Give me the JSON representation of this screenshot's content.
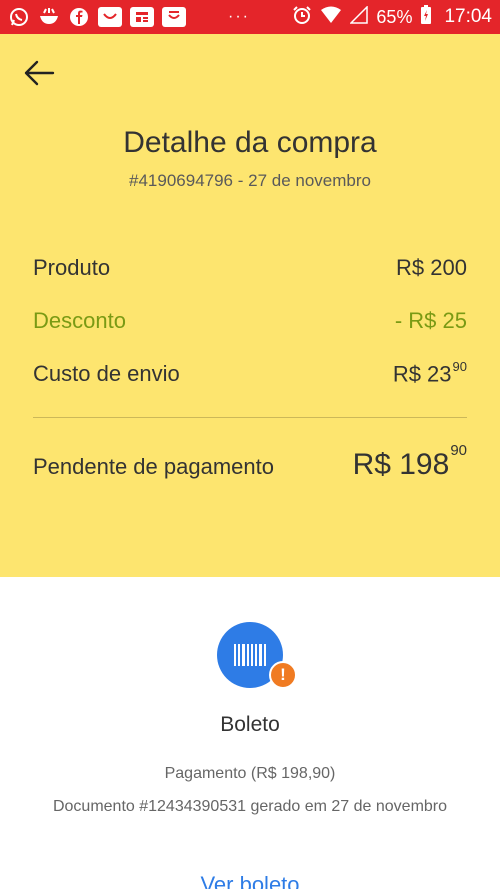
{
  "status_bar": {
    "dots": "···",
    "battery_pct": "65%",
    "time": "17:04"
  },
  "header": {
    "title": "Detalhe da compra",
    "subtitle": "#4190694796 - 27 de novembro"
  },
  "summary": {
    "product_label": "Produto",
    "product_value": "R$ 200",
    "discount_label": "Desconto",
    "discount_value": "- R$ 25",
    "shipping_label": "Custo de envio",
    "shipping_value": "R$ 23",
    "shipping_cents": "90",
    "total_label": "Pendente de pagamento",
    "total_value": "R$ 198",
    "total_cents": "90"
  },
  "payment": {
    "method": "Boleto",
    "amount_text": "Pagamento (R$ 198,90)",
    "document_text": "Documento #12434390531 gerado em 27 de novembro",
    "link": "Ver boleto",
    "badge": "!"
  },
  "colors": {
    "status_bar": "#e4252a",
    "header_bg": "#fde56f",
    "discount": "#7a9a14",
    "accent_blue": "#2e7ce6",
    "badge_orange": "#f07b22"
  }
}
